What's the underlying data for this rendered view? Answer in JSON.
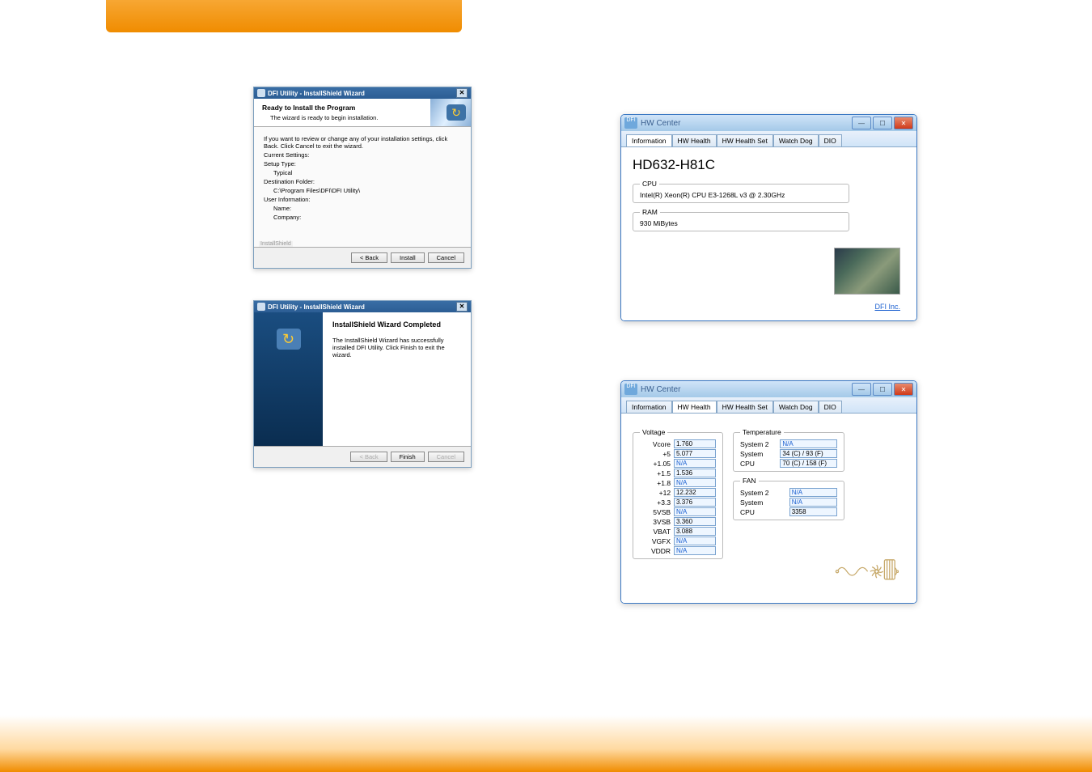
{
  "installer1": {
    "window_title": "DFI Utility - InstallShield Wizard",
    "close": "✕",
    "header_title": "Ready to Install the Program",
    "header_subtitle": "The wizard is ready to begin installation.",
    "body_instruction": "If you want to review or change any of your installation settings, click Back. Click Cancel to exit the wizard.",
    "current_settings_label": "Current Settings:",
    "setup_type_label": "Setup Type:",
    "setup_type_value": "Typical",
    "destination_label": "Destination Folder:",
    "destination_value": "C:\\Program Files\\DFI\\DFI Utility\\",
    "user_info_label": "User Information:",
    "name_label": "Name:",
    "company_label": "Company:",
    "installshield_label": "InstallShield",
    "btn_back": "< Back",
    "btn_install": "Install",
    "btn_cancel": "Cancel"
  },
  "installer2": {
    "window_title": "DFI Utility - InstallShield Wizard",
    "close": "✕",
    "title": "InstallShield Wizard Completed",
    "body_text": "The InstallShield Wizard has successfully installed DFI Utility. Click Finish to exit the wizard.",
    "btn_back": "< Back",
    "btn_finish": "Finish",
    "btn_cancel": "Cancel"
  },
  "hwcenter": {
    "app_icon_text": "DFI",
    "app_title": "HW Center",
    "btn_min": "—",
    "btn_max": "☐",
    "btn_close": "✕",
    "tabs": {
      "t0": "Information",
      "t1": "HW Health",
      "t2": "HW Health Set",
      "t3": "Watch Dog",
      "t4": "DIO"
    }
  },
  "hw_info": {
    "product": "HD632-H81C",
    "cpu_legend": "CPU",
    "cpu_value": "Intel(R) Xeon(R) CPU E3-1268L v3 @ 2.30GHz",
    "ram_legend": "RAM",
    "ram_value": "930 MiBytes",
    "dfi_link": "DFI Inc."
  },
  "hw_health": {
    "voltage_legend": "Voltage",
    "voltage_rows": {
      "r0": {
        "label": "Vcore",
        "value": "1.760"
      },
      "r1": {
        "label": "+5",
        "value": "5.077"
      },
      "r2": {
        "label": "+1.05",
        "value": "N/A"
      },
      "r3": {
        "label": "+1.5",
        "value": "1.536"
      },
      "r4": {
        "label": "+1.8",
        "value": "N/A"
      },
      "r5": {
        "label": "+12",
        "value": "12.232"
      },
      "r6": {
        "label": "+3.3",
        "value": "3.376"
      },
      "r7": {
        "label": "5VSB",
        "value": "N/A"
      },
      "r8": {
        "label": "3VSB",
        "value": "3.360"
      },
      "r9": {
        "label": "VBAT",
        "value": "3.088"
      },
      "r10": {
        "label": "VGFX",
        "value": "N/A"
      },
      "r11": {
        "label": "VDDR",
        "value": "N/A"
      }
    },
    "temp_legend": "Temperature",
    "temp_rows": {
      "r0": {
        "label": "System 2",
        "value": "N/A"
      },
      "r1": {
        "label": "System",
        "value": "34 (C) / 93 (F)"
      },
      "r2": {
        "label": "CPU",
        "value": "70 (C) / 158 (F)"
      }
    },
    "fan_legend": "FAN",
    "fan_rows": {
      "r0": {
        "label": "System 2",
        "value": "N/A"
      },
      "r1": {
        "label": "System",
        "value": "N/A"
      },
      "r2": {
        "label": "CPU",
        "value": "3358"
      }
    }
  }
}
